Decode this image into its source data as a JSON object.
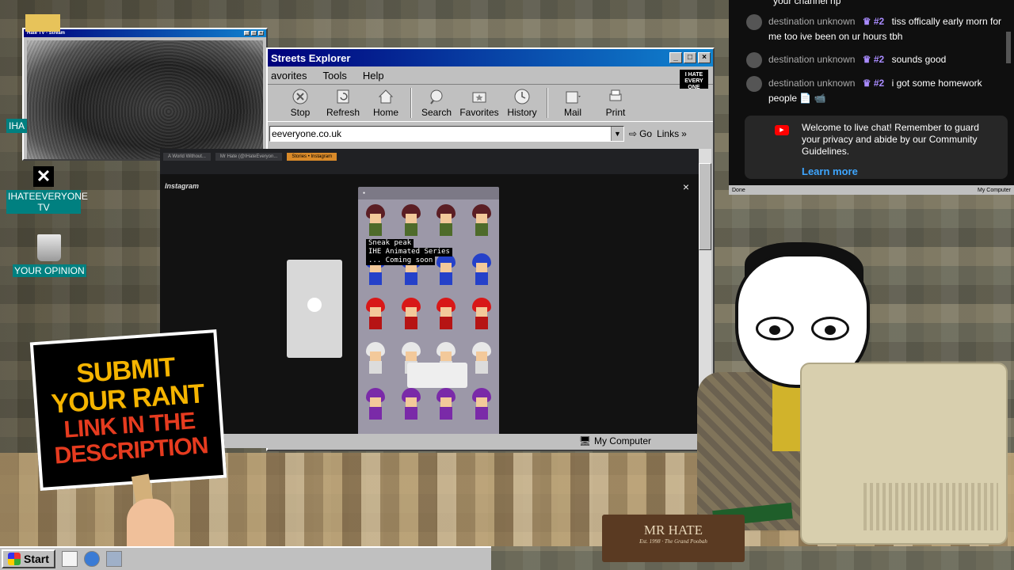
{
  "stream_window": {
    "title": "Hate TV - Stream",
    "controls": [
      "_",
      "□",
      "×"
    ]
  },
  "desktop": {
    "icons": [
      {
        "label": "IHATEEVERYONE TV",
        "icon": "x-logo-icon"
      },
      {
        "label": "YOUR OPINION",
        "icon": "recycle-bin-icon"
      }
    ],
    "partial_label": "IHA"
  },
  "explorer": {
    "title": "Streets Explorer",
    "controls": [
      "_",
      "□",
      "×"
    ],
    "menu": [
      "avorites",
      "Tools",
      "Help"
    ],
    "toolbar": [
      {
        "label": "Stop",
        "icon": "stop-icon"
      },
      {
        "label": "Refresh",
        "icon": "refresh-icon"
      },
      {
        "label": "Home",
        "icon": "home-icon"
      },
      {
        "label": "Search",
        "icon": "search-icon"
      },
      {
        "label": "Favorites",
        "icon": "favorites-icon"
      },
      {
        "label": "History",
        "icon": "history-icon"
      },
      {
        "label": "Mail",
        "icon": "mail-icon"
      },
      {
        "label": "Print",
        "icon": "print-icon"
      }
    ],
    "address": "eeveryone.co.uk",
    "go_label": "Go",
    "links_label": "Links",
    "status_text": "My Computer",
    "brand_logo": "I HATE EVERY ONE"
  },
  "instagram": {
    "logo": "Instagram",
    "close": "×",
    "tabs": [
      "A World Without...",
      "Mr Hate (@IHateEveryon...",
      "Stories • Instagram"
    ],
    "story_caption": [
      "Sneak peak",
      "IHE Animated Series",
      "... Coming soon"
    ]
  },
  "chat": {
    "partial_top": "your channel rip",
    "messages": [
      {
        "author": "destination unknown",
        "badge": "#2",
        "text": "tiss offically early morn for me too ive been on ur hours tbh"
      },
      {
        "author": "destination unknown",
        "badge": "#2",
        "text": "sounds good"
      },
      {
        "author": "destination unknown",
        "badge": "#2",
        "text": "i got some homework people 📄 📹"
      }
    ],
    "notice": "Welcome to live chat! Remember to guard your privacy and abide by our Community Guidelines.",
    "learn_more": "Learn more",
    "status_left": "Done",
    "status_right": "My Computer"
  },
  "sign": {
    "line1": "SUBMIT",
    "line2": "YOUR RANT",
    "line3": "LINK IN THE",
    "line4": "DESCRIPTION"
  },
  "nameplate": {
    "name": "MR HATE",
    "subtitle": "Est. 1998 · The Grand Poobah"
  },
  "taskbar": {
    "start_label": "Start"
  },
  "colors": {
    "title_bar": "#00007b",
    "sign_yellow": "#f5b400",
    "sign_red": "#e63b1f",
    "chat_badge": "#a98bff",
    "learn_more": "#3ea6ff"
  }
}
